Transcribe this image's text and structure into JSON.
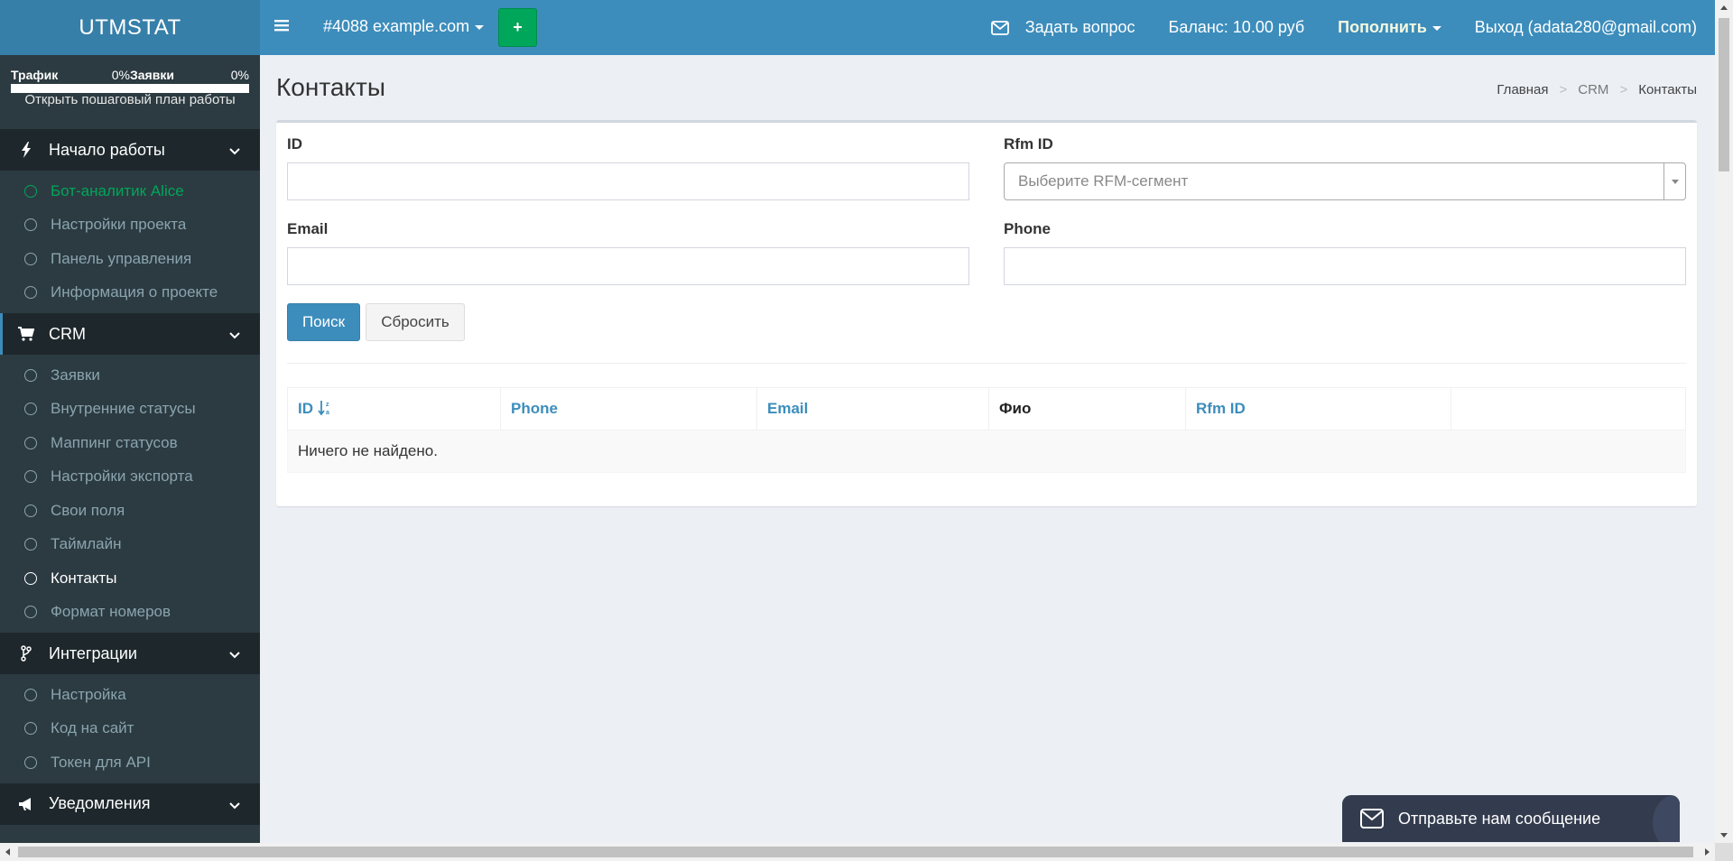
{
  "brand": "UTMSTAT",
  "progress": [
    {
      "label": "Трафик",
      "percent_text": "0%",
      "value": 0
    },
    {
      "label": "Заявки",
      "percent_text": "0%",
      "value": 0
    }
  ],
  "plan_link": "Открыть пошаговый план работы",
  "sections": [
    {
      "title": "Начало работы",
      "icon": "bolt-icon",
      "items": [
        "Бот-аналитик Alice",
        "Настройки проекта",
        "Панель управления",
        "Информация о проекте"
      ]
    },
    {
      "title": "CRM",
      "icon": "cart-icon",
      "items": [
        "Заявки",
        "Внутренние статусы",
        "Маппинг статусов",
        "Настройки экспорта",
        "Свои поля",
        "Таймлайн",
        "Контакты",
        "Формат номеров"
      ]
    },
    {
      "title": "Интеграции",
      "icon": "branch-icon",
      "items": [
        "Настройка",
        "Код на сайт",
        "Токен для API"
      ]
    },
    {
      "title": "Уведомления",
      "icon": "bullhorn-icon",
      "items": []
    }
  ],
  "header": {
    "project": "#4088 example.com",
    "add_label": "+",
    "ask": "Задать вопрос",
    "balance": "Баланс: 10.00 руб",
    "topup": "Пополнить",
    "logout": "Выход (adata280@gmail.com)"
  },
  "page": {
    "title": "Контакты",
    "breadcrumb": [
      "Главная",
      "CRM",
      "Контакты"
    ]
  },
  "form": {
    "id_label": "ID",
    "rfm_label": "Rfm ID",
    "rfm_placeholder": "Выберите RFM-сегмент",
    "email_label": "Email",
    "phone_label": "Phone",
    "search": "Поиск",
    "reset": "Сбросить"
  },
  "table": {
    "columns": [
      "ID",
      "Phone",
      "Email",
      "Фио",
      "Rfm ID",
      ""
    ],
    "empty": "Ничего не найдено."
  },
  "chat": {
    "label": "Отправьте нам сообщение"
  },
  "colors": {
    "header": "#3c8dbc",
    "logo": "#367fa9",
    "sidebar": "#222d32",
    "accent_green": "#00a65a"
  }
}
